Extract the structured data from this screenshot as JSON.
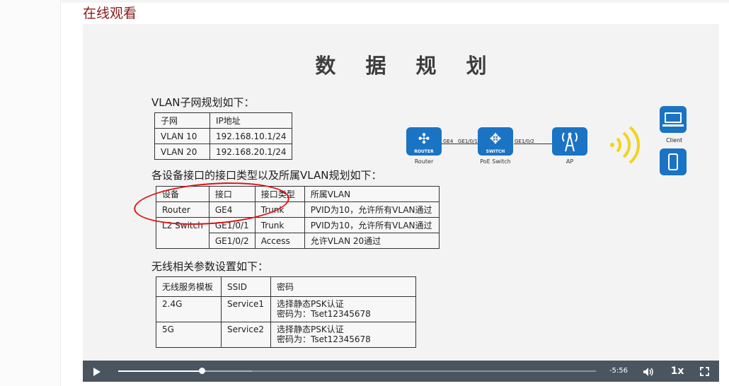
{
  "page": {
    "section_title": "在线观看"
  },
  "slide": {
    "title": "数 据 规 划",
    "vlan_heading": "VLAN子网规划如下：",
    "vlan_table": {
      "headers": [
        "子网",
        "IP地址"
      ],
      "rows": [
        [
          "VLAN 10",
          "192.168.10.1/24"
        ],
        [
          "VLAN 20",
          "192.168.20.1/24"
        ]
      ]
    },
    "port_heading": "各设备接口的接口类型以及所属VLAN规划如下：",
    "port_table": {
      "headers": [
        "设备",
        "接口",
        "接口类型",
        "所属VLAN"
      ],
      "rows": [
        [
          "Router",
          "GE4",
          "Trunk",
          "PVID为10，允许所有VLAN通过"
        ],
        [
          "L2 Switch",
          "GE1/0/1",
          "Trunk",
          "PVID为10，允许所有VLAN通过"
        ],
        [
          "",
          "GE1/0/2",
          "Access",
          "允许VLAN 20通过"
        ]
      ]
    },
    "wireless_heading": "无线相关参数设置如下：",
    "wireless_table": {
      "headers": [
        "无线服务模板",
        "SSID",
        "密码"
      ],
      "rows": [
        [
          "2.4G",
          "Service1",
          "选择静态PSK认证",
          "密码为：Tset12345678"
        ],
        [
          "5G",
          "Service2",
          "选择静态PSK认证",
          "密码为：Tset12345678"
        ]
      ]
    },
    "topology": {
      "router": {
        "name": "Router",
        "caption": "ROUTER",
        "icon": "router-icon"
      },
      "switch": {
        "name": "PoE Switch",
        "caption": "SWITCH",
        "icon": "switch-icon"
      },
      "ap": {
        "name": "AP",
        "icon": "ap-icon"
      },
      "client": {
        "name": "Client",
        "icons": [
          "laptop-icon",
          "phone-icon"
        ]
      },
      "ports": [
        "GE4",
        "GE1/0/1",
        "GE1/0/2"
      ]
    }
  },
  "player": {
    "time_remaining": "-5:56",
    "speed": "1x",
    "progress_fraction": 0.175,
    "buffered_fraction": 0.28
  },
  "colors": {
    "accent": "#8b1a1a",
    "device_blue": "#1b73c4",
    "highlight_red": "#e01010",
    "wifi_yellow": "#f2d31a",
    "controls_bg": "#4a5560"
  }
}
